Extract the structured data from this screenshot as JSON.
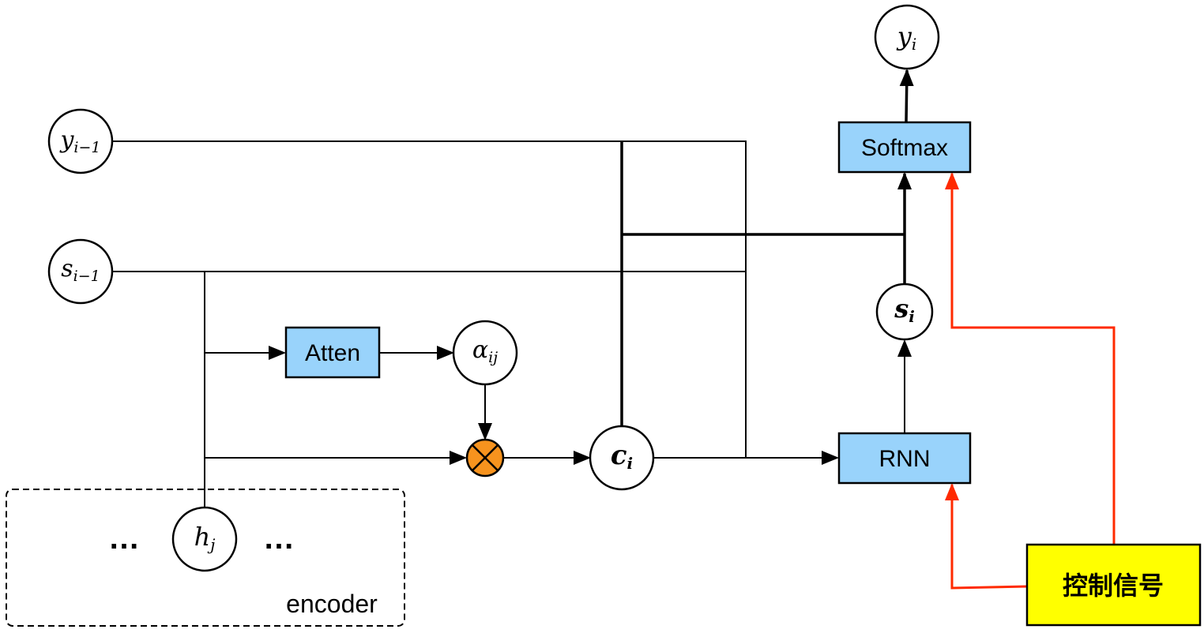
{
  "colors": {
    "box_fill": "#99d3fb",
    "control_fill": "#ffff00",
    "control_arrow": "#ff2a00",
    "multiply_fill": "#f7931e"
  },
  "nodes": {
    "y_i": {
      "base": "y",
      "sub": "i"
    },
    "y_prev": {
      "base": "y",
      "sub": "i−1"
    },
    "s_prev": {
      "base": "s",
      "sub": "i−1"
    },
    "s_i": {
      "base": "s",
      "sub": "i"
    },
    "alpha": {
      "base": "α",
      "sub": "ij"
    },
    "c_i": {
      "base": "c",
      "sub": "i"
    },
    "h_j": {
      "base": "h",
      "sub": "j"
    }
  },
  "boxes": {
    "softmax": "Softmax",
    "atten": "Atten",
    "rnn": "RNN",
    "control": "控制信号"
  },
  "encoder": {
    "label": "encoder",
    "dots_left": "…",
    "dots_right": "…"
  },
  "multiply_icon": "circled-times-icon"
}
